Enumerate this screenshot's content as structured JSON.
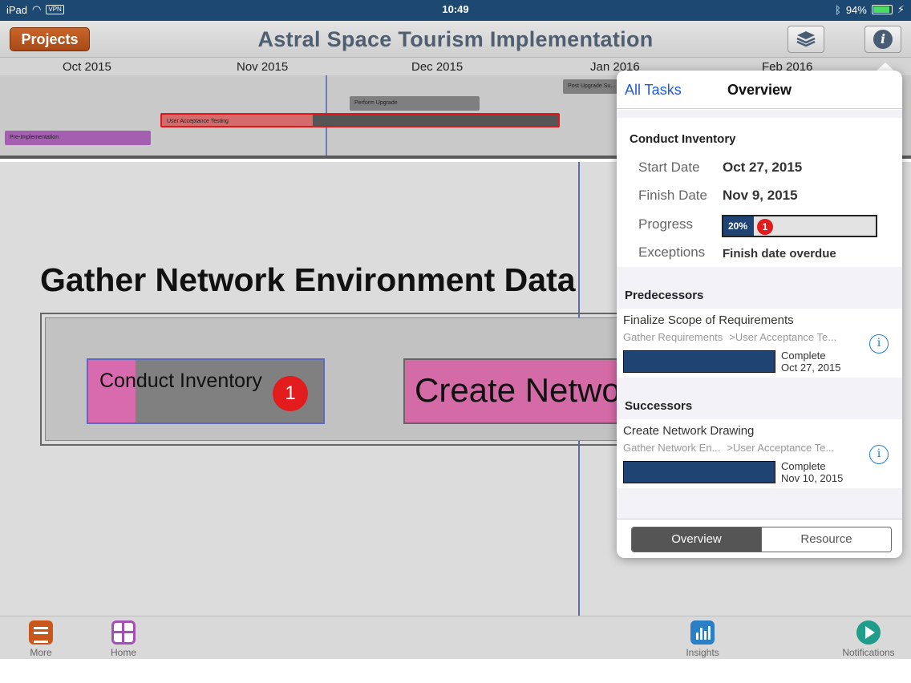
{
  "status_bar": {
    "device": "iPad",
    "vpn": "VPN",
    "time": "10:49",
    "battery": "94%",
    "battery_level": 0.94
  },
  "header": {
    "projects_button": "Projects",
    "title": "Astral Space Tourism Implementation",
    "layers_icon": "layers-icon",
    "info_icon": "info-icon",
    "info_glyph": "i"
  },
  "timeline": {
    "months": [
      "Oct 2015",
      "Nov 2015",
      "Dec 2015",
      "Jan 2016",
      "Feb 2016"
    ],
    "bars": {
      "pre_implementation": "Pre-Implementation",
      "user_acceptance": "User Acceptance Testing",
      "perform_upgrade": "Perform Upgrade",
      "post_upgrade": "Post Upgrade Su..."
    }
  },
  "canvas": {
    "group_title": "Gather Network Environment Data",
    "task_conduct": {
      "label": "Conduct Inventory",
      "badge": "1",
      "progress": 0.2
    },
    "task_create": {
      "label": "Create Network Drawing"
    }
  },
  "popover": {
    "back_label": "All Tasks",
    "title": "Overview",
    "task_name": "Conduct Inventory",
    "start_label": "Start Date",
    "start_value": "Oct 27, 2015",
    "finish_label": "Finish Date",
    "finish_value": "Nov 9, 2015",
    "progress_label": "Progress",
    "progress_value": "20%",
    "progress_badge": "1",
    "exceptions_label": "Exceptions",
    "exceptions_value": "Finish date overdue",
    "predecessors_header": "Predecessors",
    "predecessor": {
      "name": "Finalize Scope of Requirements",
      "path_1": "Gather Requirements",
      "path_2": ">User Acceptance Te...",
      "status": "Complete",
      "date": "Oct 27, 2015"
    },
    "successors_header": "Successors",
    "successor": {
      "name": "Create Network Drawing",
      "path_1": "Gather Network En...",
      "path_2": ">User Acceptance Te...",
      "status": "Complete",
      "date": "Nov 10, 2015"
    },
    "info_glyph": "i",
    "segments": {
      "overview": "Overview",
      "resource": "Resource"
    }
  },
  "toolbar": {
    "more": "More",
    "home": "Home",
    "insights": "Insights",
    "notifications": "Notifications"
  },
  "colors": {
    "status_bar": "#1c4871",
    "accent_orange": "#c9571c",
    "progress_fill": "#1f4474",
    "link_blue": "#1e5bd8",
    "overdue_red": "#e21c1c",
    "task_pink": "#d86aae"
  }
}
